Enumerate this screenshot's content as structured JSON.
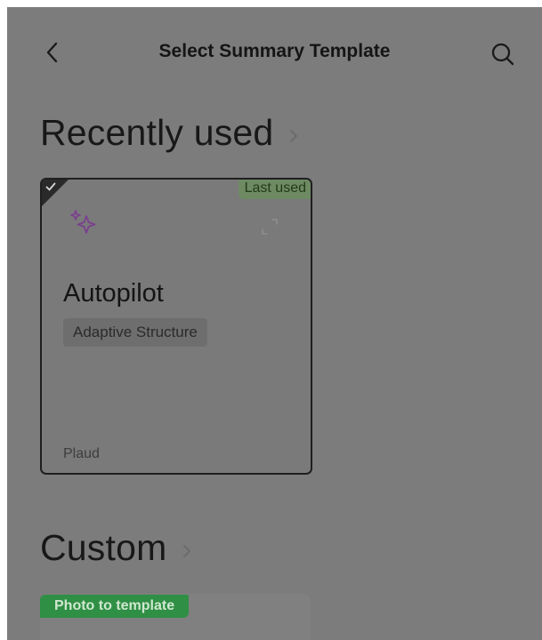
{
  "header": {
    "title": "Select Summary Template",
    "back_icon": "chevron-left-icon",
    "search_icon": "search-icon"
  },
  "recently_used": {
    "heading": "Recently used",
    "card": {
      "badge": "Last used",
      "icon": "sparkles-icon",
      "title": "Autopilot",
      "tag": "Adaptive Structure",
      "source": "Plaud",
      "selected": true
    }
  },
  "custom": {
    "heading": "Custom",
    "photo_tag": "Photo to template"
  },
  "colors": {
    "overlay": "#7c7c7c",
    "badge_green": "#6e8a63",
    "photo_tag_green": "#2f8f45",
    "sparkle_purple": "#7a3f8f"
  }
}
